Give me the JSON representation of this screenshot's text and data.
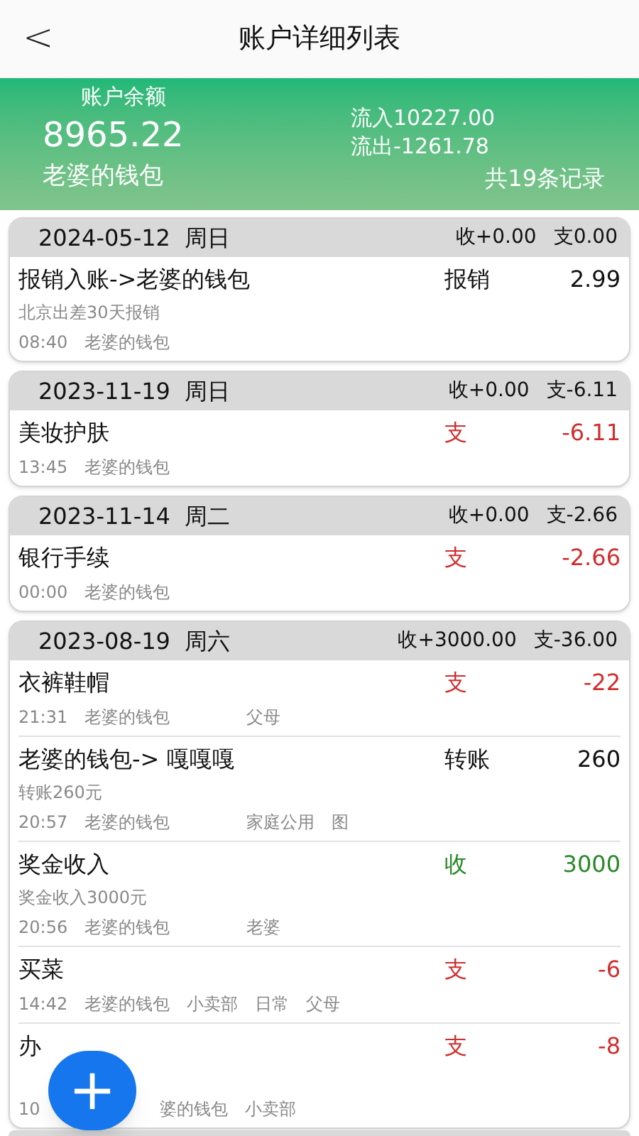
{
  "header": {
    "back": "<",
    "title": "账户详细列表"
  },
  "summary": {
    "balance_label": "账户余额",
    "balance": "8965.22",
    "account": "老婆的钱包",
    "inflow": "流入10227.00",
    "outflow": "流出-1261.78",
    "count": "共19条记录"
  },
  "groups": [
    {
      "date": "2024-05-12",
      "weekday": "周日",
      "income": "收+0.00",
      "expense": "支0.00",
      "records": [
        {
          "title": "报销入账->老婆的钱包",
          "type": "报销",
          "kind": "neutral",
          "amount": "2.99",
          "memo": "北京出差30天报销",
          "time": "08:40",
          "wallet": "老婆的钱包"
        }
      ]
    },
    {
      "date": "2023-11-19",
      "weekday": "周日",
      "income": "收+0.00",
      "expense": "支-6.11",
      "records": [
        {
          "title": "美妆护肤",
          "type": "支",
          "kind": "expense",
          "amount": "-6.11",
          "time": "13:45",
          "wallet": "老婆的钱包"
        }
      ]
    },
    {
      "date": "2023-11-14",
      "weekday": "周二",
      "income": "收+0.00",
      "expense": "支-2.66",
      "records": [
        {
          "title": "银行手续",
          "type": "支",
          "kind": "expense",
          "amount": "-2.66",
          "time": "00:00",
          "wallet": "老婆的钱包"
        }
      ]
    },
    {
      "date": "2023-08-19",
      "weekday": "周六",
      "income": "收+3000.00",
      "expense": "支-36.00",
      "records": [
        {
          "title": "衣裤鞋帽",
          "type": "支",
          "kind": "expense",
          "amount": "-22",
          "time": "21:31",
          "wallet": "老婆的钱包",
          "tags": [
            "父母"
          ]
        },
        {
          "title": "老婆的钱包-> 嘎嘎嘎",
          "type": "转账",
          "kind": "neutral",
          "amount": "260",
          "memo": "转账260元",
          "time": "20:57",
          "wallet": "老婆的钱包",
          "tags": [
            "家庭公用",
            "图"
          ]
        },
        {
          "title": "奖金收入",
          "type": "收",
          "kind": "income",
          "amount": "3000",
          "memo": "奖金收入3000元",
          "time": "20:56",
          "wallet": "老婆的钱包",
          "tags": [
            "老婆"
          ]
        },
        {
          "title": "买菜",
          "type": "支",
          "kind": "expense",
          "amount": "-6",
          "time": "14:42",
          "wallet": "老婆的钱包",
          "shop": "小卖部",
          "tags": [
            "日常",
            "父母"
          ]
        },
        {
          "title": "办",
          "type": "支",
          "kind": "expense",
          "amount": "-8",
          "time": "10",
          "wallet": "婆的钱包",
          "shop": "小卖部",
          "covered": true
        }
      ]
    }
  ],
  "fab": {
    "label": "+"
  }
}
